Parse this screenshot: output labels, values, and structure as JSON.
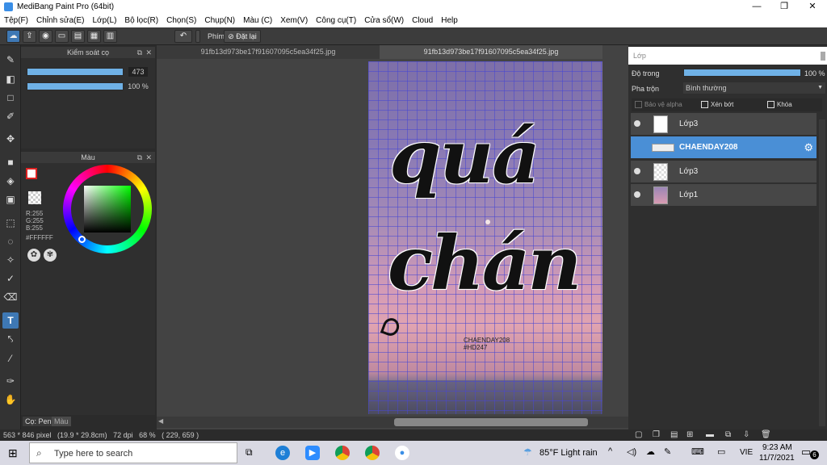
{
  "window": {
    "title": "MediBang Paint Pro (64bit)",
    "minimize": "—",
    "maximize": "❐",
    "close": "✕"
  },
  "menu": [
    "Tệp(F)",
    "Chỉnh sửa(E)",
    "Lớp(L)",
    "Bộ lọc(R)",
    "Chọn(S)",
    "Chụp(N)",
    "Màu (C)",
    "Xem(V)",
    "Công cụ(T)",
    "Cửa sổ(W)",
    "Cloud",
    "Help"
  ],
  "toolbar": {
    "shortcut_label": "Phím",
    "reset_label": "Đặt lại"
  },
  "brush_panel": {
    "title": "Kiểm soát cọ",
    "size_value": "473",
    "opacity_value": "100 %"
  },
  "color_panel": {
    "title": "Màu",
    "r": "R:255",
    "g": "G:255",
    "b": "B:255",
    "hex": "#FFFFFF"
  },
  "tabs": [
    "91fb13d973be17f91607095c5ea34f25.jpg",
    "91fb13d973be17f91607095c5ea34f25.jpg"
  ],
  "canvas_text": {
    "line1": "quá",
    "line2": "chán",
    "credit1": "CHAENDAY208",
    "credit2": "#HD247"
  },
  "layers_panel": {
    "title": "Lớp",
    "opacity_label": "Độ trong",
    "opacity_value": "100 %",
    "blend_label": "Pha trộn",
    "blend_value": "Bình thường",
    "protect_alpha": "Bảo vệ alpha",
    "clipping": "Xén bớt",
    "lock": "Khóa",
    "layers": [
      {
        "name": "Lớp3",
        "selected": false
      },
      {
        "name": "CHAENDAY208",
        "selected": true
      },
      {
        "name": "Lớp3",
        "selected": false
      },
      {
        "name": "Lớp1",
        "selected": false
      }
    ]
  },
  "left_tabs": {
    "pen": "Cọ: Pen",
    "color": "Màu"
  },
  "status": {
    "text": "563 * 846 pixel   (19.9 * 29.8cm)   72 dpi   68 %   ( 229, 659 )"
  },
  "taskbar": {
    "search_placeholder": "Type here to search",
    "weather": "85°F  Light rain",
    "language": "VIE",
    "time": "9:23 AM",
    "date": "11/7/2021",
    "notification_count": "6"
  },
  "colors": {
    "accent": "#4a8fd6",
    "panel": "#2f2f2f",
    "slider": "#6fb1e6"
  }
}
